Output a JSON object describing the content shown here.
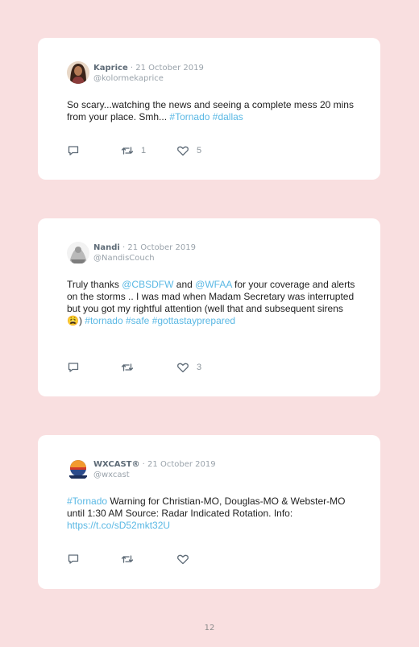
{
  "tweets": [
    {
      "name": "Kaprice",
      "date": "21 October 2019",
      "handle": "@kolormekaprice",
      "segments": [
        {
          "text": "So scary...watching the news and seeing a complete mess 20 mins from your place. Smh... ",
          "link": false
        },
        {
          "text": "#Tornado",
          "link": true
        },
        {
          "text": " ",
          "link": false
        },
        {
          "text": "#dallas",
          "link": true
        }
      ],
      "retweets": "1",
      "likes": "5"
    },
    {
      "name": "Nandi",
      "date": "21 October 2019",
      "handle": "@NandisCouch",
      "segments": [
        {
          "text": "Truly thanks ",
          "link": false
        },
        {
          "text": "@CBSDFW",
          "link": true
        },
        {
          "text": " and ",
          "link": false
        },
        {
          "text": "@WFAA",
          "link": true
        },
        {
          "text": " for your coverage and alerts on the storms .. I was mad when Madam Secretary was interrupted but you got my rightful attention (well that and subsequent sirens 😩) ",
          "link": false
        },
        {
          "text": "#tornado",
          "link": true
        },
        {
          "text": " ",
          "link": false
        },
        {
          "text": "#safe",
          "link": true
        },
        {
          "text": " ",
          "link": false
        },
        {
          "text": "#gottastayprepared",
          "link": true
        }
      ],
      "retweets": "",
      "likes": "3"
    },
    {
      "name": "WXCAST®",
      "date": "21 October 2019",
      "handle": "@wxcast",
      "segments": [
        {
          "text": "#Tornado",
          "link": true
        },
        {
          "text": " Warning for Christian-MO, Douglas-MO & Webster-MO until 1:30 AM Source: Radar Indicated Rotation. Info: ",
          "link": false
        },
        {
          "text": "https://t.co/sD52mkt32U",
          "link": true
        }
      ],
      "retweets": "",
      "likes": ""
    }
  ],
  "separator": " · ",
  "icons": {
    "reply": "reply-icon",
    "retweet": "retweet-icon",
    "like": "heart-icon"
  },
  "colors": {
    "background": "#f9dfe0",
    "card": "#ffffff",
    "link": "#5ab8e4"
  },
  "page_number": "12"
}
